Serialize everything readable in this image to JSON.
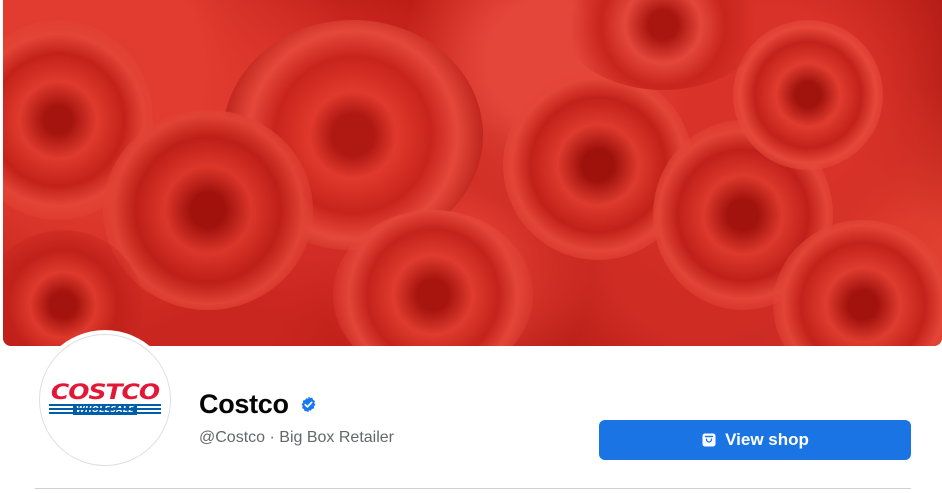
{
  "page": {
    "name": "Costco",
    "handle": "@Costco",
    "separator": "·",
    "category": "Big Box Retailer",
    "verified": true
  },
  "logo": {
    "main": "COSTCO",
    "sub": "WHOLESALE"
  },
  "actions": {
    "shop_label": "View shop"
  },
  "icons": {
    "verified": "verified-badge-icon",
    "shop": "shopping-bag-icon"
  },
  "colors": {
    "primary_button": "#1b74e4",
    "verified_badge": "#1877f2",
    "cover_base": "#c52119",
    "logo_red": "#e31837",
    "logo_blue": "#005daa",
    "subtitle_text": "#65676b"
  }
}
